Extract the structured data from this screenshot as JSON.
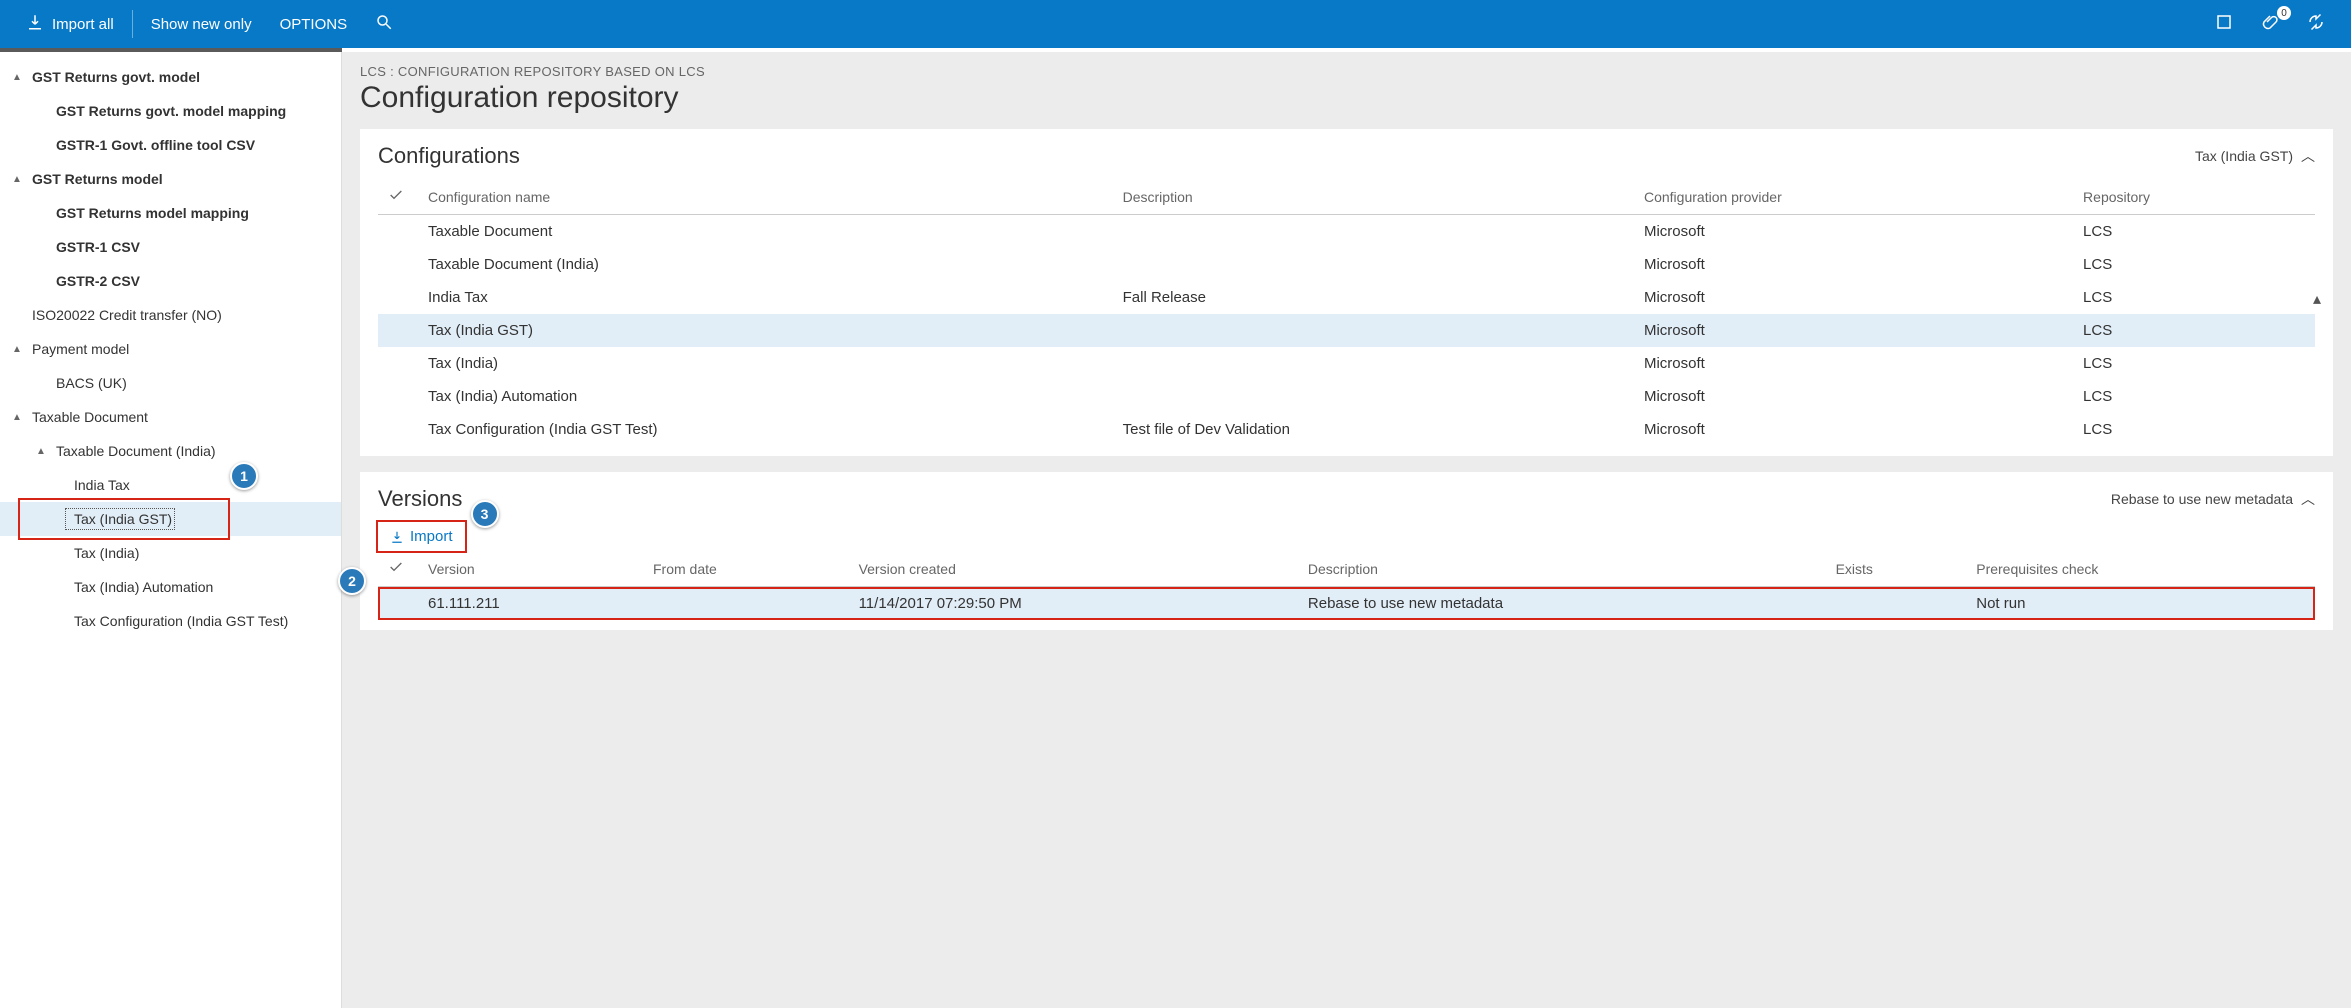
{
  "toolbar": {
    "import_all": "Import all",
    "show_new_only": "Show new only",
    "options": "OPTIONS",
    "badge_count": "0"
  },
  "tree": [
    {
      "level": 1,
      "caret": "▲",
      "label": "GST Returns govt. model",
      "bold": true
    },
    {
      "level": 2,
      "caret": "",
      "label": "GST Returns govt. model mapping",
      "bold": true
    },
    {
      "level": 2,
      "caret": "",
      "label": "GSTR-1 Govt. offline tool CSV",
      "bold": true
    },
    {
      "level": 1,
      "caret": "▲",
      "label": "GST Returns model",
      "bold": true
    },
    {
      "level": 2,
      "caret": "",
      "label": "GST Returns model mapping",
      "bold": true
    },
    {
      "level": 2,
      "caret": "",
      "label": "GSTR-1 CSV",
      "bold": true
    },
    {
      "level": 2,
      "caret": "",
      "label": "GSTR-2 CSV",
      "bold": true
    },
    {
      "level": 1,
      "caret": "",
      "label": "ISO20022 Credit transfer (NO)",
      "bold": false
    },
    {
      "level": 1,
      "caret": "▲",
      "label": "Payment model",
      "bold": false
    },
    {
      "level": 2,
      "caret": "",
      "label": "BACS (UK)",
      "bold": false
    },
    {
      "level": 1,
      "caret": "▲",
      "label": "Taxable Document",
      "bold": false
    },
    {
      "level": 2,
      "caret": "▲",
      "label": "Taxable Document (India)",
      "bold": false
    },
    {
      "level": 3,
      "caret": "",
      "label": "India Tax",
      "bold": false
    },
    {
      "level": 3,
      "caret": "",
      "label": "Tax (India GST)",
      "bold": false,
      "selected": true
    },
    {
      "level": 3,
      "caret": "",
      "label": "Tax (India)",
      "bold": false
    },
    {
      "level": 3,
      "caret": "",
      "label": "Tax (India) Automation",
      "bold": false
    },
    {
      "level": 3,
      "caret": "",
      "label": "Tax Configuration (India GST Test)",
      "bold": false
    }
  ],
  "breadcrumb": "LCS : CONFIGURATION REPOSITORY BASED ON LCS",
  "page_title": "Configuration repository",
  "configurations": {
    "title": "Configurations",
    "subtitle": "Tax (India GST)",
    "columns": [
      "Configuration name",
      "Description",
      "Configuration provider",
      "Repository"
    ],
    "rows": [
      {
        "name": "Taxable Document",
        "desc": "",
        "provider": "Microsoft",
        "repo": "LCS"
      },
      {
        "name": "Taxable Document (India)",
        "desc": "",
        "provider": "Microsoft",
        "repo": "LCS"
      },
      {
        "name": "India Tax",
        "desc": "Fall Release",
        "provider": "Microsoft",
        "repo": "LCS"
      },
      {
        "name": "Tax (India GST)",
        "desc": "",
        "provider": "Microsoft",
        "repo": "LCS",
        "selected": true
      },
      {
        "name": "Tax (India)",
        "desc": "",
        "provider": "Microsoft",
        "repo": "LCS"
      },
      {
        "name": "Tax (India) Automation",
        "desc": "",
        "provider": "Microsoft",
        "repo": "LCS"
      },
      {
        "name": "Tax Configuration (India GST Test)",
        "desc": "Test file of Dev Validation",
        "provider": "Microsoft",
        "repo": "LCS"
      }
    ]
  },
  "versions": {
    "title": "Versions",
    "subtitle": "Rebase to use new metadata",
    "import_label": "Import",
    "columns": [
      "Version",
      "From date",
      "Version created",
      "Description",
      "Exists",
      "Prerequisites check"
    ],
    "rows": [
      {
        "version": "61.111.211",
        "from": "",
        "created": "11/14/2017 07:29:50 PM",
        "desc": "Rebase to use new metadata",
        "exists": "",
        "prereq": "Not run",
        "selected": true
      }
    ]
  },
  "callouts": {
    "c1": "1",
    "c2": "2",
    "c3": "3"
  }
}
